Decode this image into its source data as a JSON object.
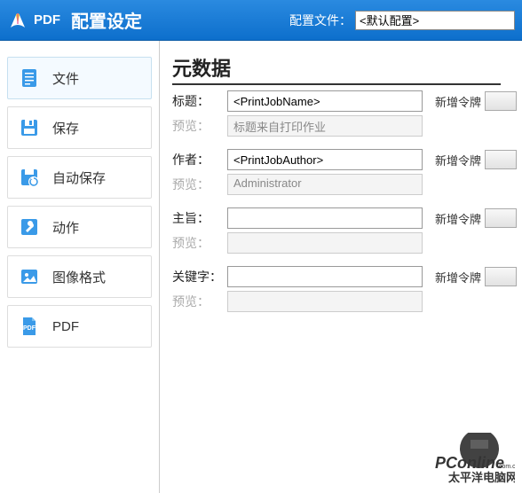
{
  "titlebar": {
    "logo_text": "PDF",
    "title": "配置设定",
    "config_label": "配置文件：",
    "config_value": "<默认配置>"
  },
  "sidebar": {
    "items": [
      {
        "label": "文件"
      },
      {
        "label": "保存"
      },
      {
        "label": "自动保存"
      },
      {
        "label": "动作"
      },
      {
        "label": "图像格式"
      },
      {
        "label": "PDF"
      }
    ]
  },
  "content": {
    "section_title": "元数据",
    "token_button_label": "新增令牌",
    "fields": [
      {
        "label": "标题：",
        "value": "<PrintJobName>",
        "preview_label": "预览：",
        "preview": "标题来自打印作业"
      },
      {
        "label": "作者：",
        "value": "<PrintJobAuthor>",
        "preview_label": "预览：",
        "preview": "Administrator"
      },
      {
        "label": "主旨：",
        "value": "",
        "preview_label": "预览：",
        "preview": ""
      },
      {
        "label": "关键字：",
        "value": "",
        "preview_label": "预览：",
        "preview": ""
      }
    ]
  },
  "watermark": {
    "line1": "PConline",
    "line2": "太平洋电脑网",
    "suffix": ".com.cn"
  }
}
